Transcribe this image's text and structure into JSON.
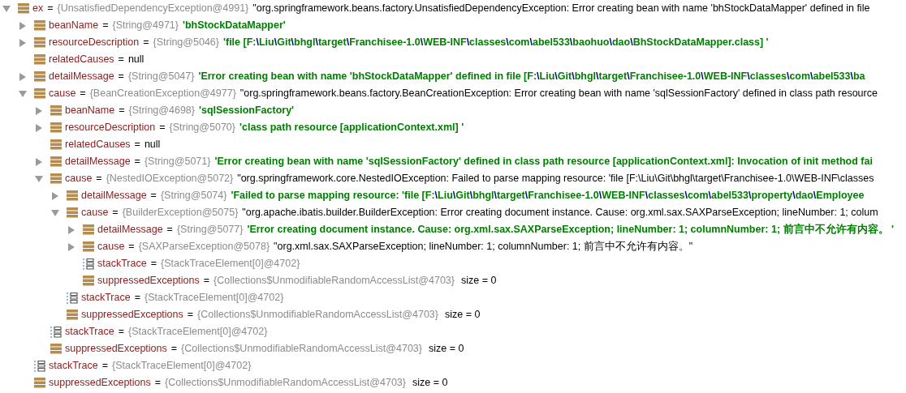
{
  "variables": [
    {
      "name": "ex",
      "operator": "=",
      "ref": "{UnsatisfiedDependencyException@4991}",
      "value": "\"org.springframework.beans.factory.UnsatisfiedDependencyException: Error creating bean with name 'bhStockDataMapper' defined in file",
      "kind": "object",
      "expanded": true,
      "children": [
        {
          "name": "beanName",
          "operator": "=",
          "ref": "{String@4971}",
          "value": "'bhStockDataMapper'",
          "kind": "string",
          "expanded": false
        },
        {
          "name": "resourceDescription",
          "operator": "=",
          "ref": "{String@5046}",
          "value": "'file [F:\\Liu\\Git\\bhgl\\target\\Franchisee-1.0\\WEB-INF\\classes\\com\\abel533\\baohuo\\dao\\BhStockDataMapper.class] '",
          "kind": "string",
          "expanded": false
        },
        {
          "name": "relatedCauses",
          "operator": "=",
          "value": "null",
          "kind": "null"
        },
        {
          "name": "detailMessage",
          "operator": "=",
          "ref": "{String@5047}",
          "value": "'Error creating bean with name 'bhStockDataMapper' defined in file [F:\\Liu\\Git\\bhgl\\target\\Franchisee-1.0\\WEB-INF\\classes\\com\\abel533\\ba",
          "kind": "string",
          "expanded": false
        },
        {
          "name": "cause",
          "operator": "=",
          "ref": "{BeanCreationException@4977}",
          "value": "\"org.springframework.beans.factory.BeanCreationException: Error creating bean with name 'sqlSessionFactory' defined in class path resource",
          "kind": "object",
          "expanded": true,
          "children": [
            {
              "name": "beanName",
              "operator": "=",
              "ref": "{String@4698}",
              "value": "'sqlSessionFactory'",
              "kind": "string",
              "expanded": false
            },
            {
              "name": "resourceDescription",
              "operator": "=",
              "ref": "{String@5070}",
              "value": "'class path resource [applicationContext.xml] '",
              "kind": "string",
              "expanded": false
            },
            {
              "name": "relatedCauses",
              "operator": "=",
              "value": "null",
              "kind": "null"
            },
            {
              "name": "detailMessage",
              "operator": "=",
              "ref": "{String@5071}",
              "value": "'Error creating bean with name 'sqlSessionFactory' defined in class path resource [applicationContext.xml]: Invocation of init method fai",
              "kind": "string",
              "expanded": false
            },
            {
              "name": "cause",
              "operator": "=",
              "ref": "{NestedIOException@5072}",
              "value": "\"org.springframework.core.NestedIOException: Failed to parse mapping resource: 'file [F:\\Liu\\Git\\bhgl\\target\\Franchisee-1.0\\WEB-INF\\classes",
              "kind": "object",
              "expanded": true,
              "children": [
                {
                  "name": "detailMessage",
                  "operator": "=",
                  "ref": "{String@5074}",
                  "value": "'Failed to parse mapping resource: 'file [F:\\Liu\\Git\\bhgl\\target\\Franchisee-1.0\\WEB-INF\\classes\\com\\abel533\\property\\dao\\Employee",
                  "kind": "string",
                  "expanded": false
                },
                {
                  "name": "cause",
                  "operator": "=",
                  "ref": "{BuilderException@5075}",
                  "value": "\"org.apache.ibatis.builder.BuilderException: Error creating document instance.  Cause: org.xml.sax.SAXParseException; lineNumber: 1; colum",
                  "kind": "object",
                  "expanded": true,
                  "children": [
                    {
                      "name": "detailMessage",
                      "operator": "=",
                      "ref": "{String@5077}",
                      "value": "'Error creating document instance.  Cause: org.xml.sax.SAXParseException; lineNumber: 1; columnNumber: 1; 前言中不允许有内容。 '",
                      "kind": "string",
                      "expanded": false
                    },
                    {
                      "name": "cause",
                      "operator": "=",
                      "ref": "{SAXParseException@5078}",
                      "value": "\"org.xml.sax.SAXParseException; lineNumber: 1; columnNumber: 1; 前言中不允许有内容。\"",
                      "kind": "object",
                      "expanded": false
                    },
                    {
                      "name": "stackTrace",
                      "operator": "=",
                      "ref": "{StackTraceElement[0]@4702}",
                      "kind": "array"
                    },
                    {
                      "name": "suppressedExceptions",
                      "operator": "=",
                      "ref": "{Collections$UnmodifiableRandomAccessList@4703}",
                      "size": "size = 0",
                      "kind": "object"
                    }
                  ]
                },
                {
                  "name": "stackTrace",
                  "operator": "=",
                  "ref": "{StackTraceElement[0]@4702}",
                  "kind": "array"
                },
                {
                  "name": "suppressedExceptions",
                  "operator": "=",
                  "ref": "{Collections$UnmodifiableRandomAccessList@4703}",
                  "size": "size = 0",
                  "kind": "object"
                }
              ]
            },
            {
              "name": "stackTrace",
              "operator": "=",
              "ref": "{StackTraceElement[0]@4702}",
              "kind": "array"
            },
            {
              "name": "suppressedExceptions",
              "operator": "=",
              "ref": "{Collections$UnmodifiableRandomAccessList@4703}",
              "size": "size = 0",
              "kind": "object"
            }
          ]
        },
        {
          "name": "stackTrace",
          "operator": "=",
          "ref": "{StackTraceElement[0]@4702}",
          "kind": "array"
        },
        {
          "name": "suppressedExceptions",
          "operator": "=",
          "ref": "{Collections$UnmodifiableRandomAccessList@4703}",
          "size": "size = 0",
          "kind": "object"
        }
      ]
    }
  ]
}
